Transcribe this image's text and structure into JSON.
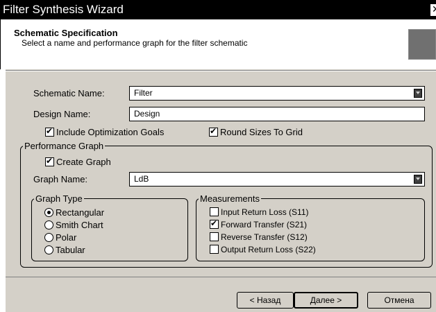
{
  "window": {
    "title": "Filter Synthesis Wizard",
    "close_glyph": "✕"
  },
  "header": {
    "title": "Schematic Specification",
    "subtitle": "Select a name and performance graph for the filter schematic"
  },
  "form": {
    "schematic_name_label": "Schematic Name:",
    "schematic_name_value": "Filter",
    "design_name_label": "Design Name:",
    "design_name_value": "Design",
    "include_optimization_label": "Include Optimization Goals",
    "include_optimization_checked": true,
    "round_sizes_label": "Round Sizes To Grid",
    "round_sizes_checked": true
  },
  "performance_graph": {
    "group_label": "Performance Graph",
    "create_graph_label": "Create Graph",
    "create_graph_checked": true,
    "graph_name_label": "Graph Name:",
    "graph_name_value": "LdB"
  },
  "graph_type": {
    "group_label": "Graph Type",
    "options": [
      {
        "label": "Rectangular",
        "selected": true
      },
      {
        "label": "Smith Chart",
        "selected": false
      },
      {
        "label": "Polar",
        "selected": false
      },
      {
        "label": "Tabular",
        "selected": false
      }
    ]
  },
  "measurements": {
    "group_label": "Measurements",
    "items": [
      {
        "label": "Input Return Loss (S11)",
        "checked": false
      },
      {
        "label": "Forward Transfer (S21)",
        "checked": true
      },
      {
        "label": "Reverse Transfer (S12)",
        "checked": false
      },
      {
        "label": "Output Return Loss (S22)",
        "checked": false
      }
    ]
  },
  "buttons": {
    "back": "< Назад",
    "next": "Далее >",
    "cancel": "Отмена"
  }
}
